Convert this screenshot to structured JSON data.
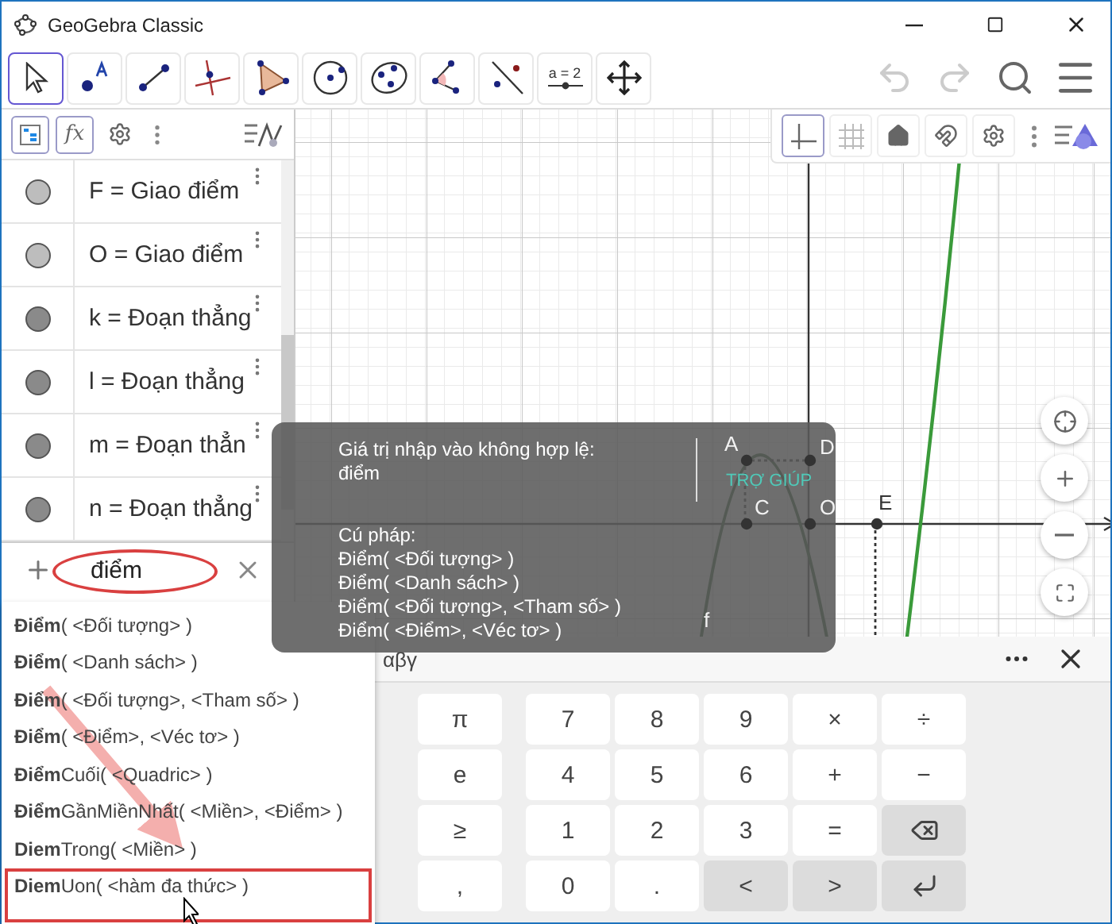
{
  "window": {
    "title": "GeoGebra Classic"
  },
  "toolbar": {
    "tools": [
      {
        "kind": "move",
        "selected": true
      },
      {
        "kind": "point",
        "selected": false
      },
      {
        "kind": "segment",
        "selected": false
      },
      {
        "kind": "perpendicular",
        "selected": false
      },
      {
        "kind": "polygon",
        "selected": false
      },
      {
        "kind": "circle",
        "selected": false
      },
      {
        "kind": "ellipse",
        "selected": false
      },
      {
        "kind": "angle",
        "selected": false
      },
      {
        "kind": "reflect",
        "selected": false
      },
      {
        "kind": "slider",
        "selected": false,
        "label": "a = 2"
      },
      {
        "kind": "pan",
        "selected": false
      }
    ]
  },
  "algebra": {
    "header_buttons": [
      {
        "kind": "tree",
        "on": true
      },
      {
        "kind": "fx",
        "on": true,
        "label": "fx"
      },
      {
        "kind": "gear",
        "on": false
      }
    ],
    "items": [
      {
        "text": "F = Giao điểm",
        "color": "#bdbdbd"
      },
      {
        "text": "O = Giao điểm",
        "color": "#bdbdbd"
      },
      {
        "text": "k = Đoạn thẳng",
        "color": "#8a8a8a"
      },
      {
        "text": "l = Đoạn thẳng",
        "color": "#8a8a8a"
      },
      {
        "text": "m = Đoạn thẳn",
        "color": "#8a8a8a"
      },
      {
        "text": "n = Đoạn thẳng",
        "color": "#8a8a8a"
      }
    ],
    "input": {
      "value": "điểm"
    }
  },
  "suggestions": [
    {
      "text": "**Điểm**( <Đối tượng> )"
    },
    {
      "text": "**Điểm**( <Danh sách> )"
    },
    {
      "text": "**Điểm**( <Đối tượng>, <Tham số> )"
    },
    {
      "text": "**Điểm**( <Điểm>, <Véc tơ> )"
    },
    {
      "text": "**Điểm**Cuối( <Quadric> )"
    },
    {
      "text": "**Điểm**GầnMiềnNhất( <Miền>, <Điểm> )"
    },
    {
      "text": "**Diem**Trong( <Miền> )"
    },
    {
      "text": "**Diem**Uon( <hàm đa thức> )"
    }
  ],
  "graphics": {
    "style_buttons": [
      {
        "kind": "axes",
        "on": true
      },
      {
        "kind": "grid",
        "on": false
      },
      {
        "kind": "home",
        "on": false
      },
      {
        "kind": "magnet",
        "on": false
      },
      {
        "kind": "gear",
        "on": false
      }
    ],
    "points": [
      {
        "label": "A"
      },
      {
        "label": "D"
      },
      {
        "label": "C"
      },
      {
        "label": "O"
      },
      {
        "label": "E"
      }
    ],
    "function_label": "f"
  },
  "error_tooltip": {
    "message": "Giá trị nhập vào không hợp lệ:",
    "value": "điểm",
    "help": "TRỢ GIÚP",
    "syntax_title": "Cú pháp:",
    "syntax": [
      "Điểm( <Đối tượng> )",
      "Điểm( <Danh sách> )",
      "Điểm( <Đối tượng>, <Tham số> )",
      "Điểm( <Điểm>, <Véc tơ> )"
    ]
  },
  "keyboard": {
    "tab": "αβγ",
    "rows": [
      [
        {
          "kind": "key",
          "label": "π"
        },
        {
          "kind": "key",
          "label": "7"
        },
        {
          "kind": "key",
          "label": "8"
        },
        {
          "kind": "key",
          "label": "9"
        },
        {
          "kind": "key",
          "label": "×"
        },
        {
          "kind": "key",
          "label": "÷"
        }
      ],
      [
        {
          "kind": "key",
          "label": "e"
        },
        {
          "kind": "key",
          "label": "4"
        },
        {
          "kind": "key",
          "label": "5"
        },
        {
          "kind": "key",
          "label": "6"
        },
        {
          "kind": "key",
          "label": "+"
        },
        {
          "kind": "key",
          "label": "−"
        }
      ],
      [
        {
          "kind": "key",
          "label": "≥"
        },
        {
          "kind": "key",
          "label": "1"
        },
        {
          "kind": "key",
          "label": "2"
        },
        {
          "kind": "key",
          "label": "3"
        },
        {
          "kind": "key",
          "label": "="
        },
        {
          "kind": "backspace"
        }
      ],
      [
        {
          "kind": "key",
          "label": ","
        },
        {
          "kind": "key",
          "label": "0"
        },
        {
          "kind": "key",
          "label": "."
        },
        {
          "kind": "nav",
          "label": "<"
        },
        {
          "kind": "nav",
          "label": ">"
        },
        {
          "kind": "enter"
        }
      ]
    ]
  }
}
